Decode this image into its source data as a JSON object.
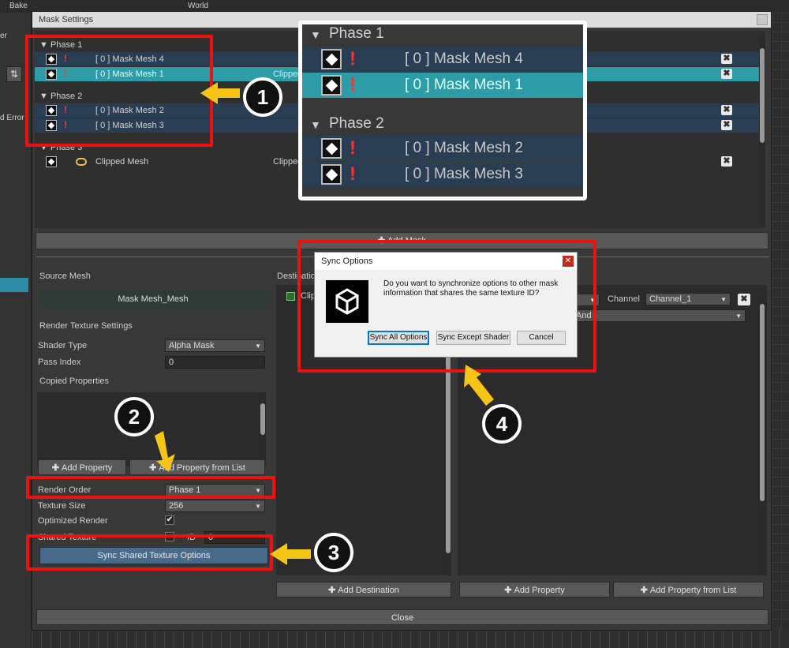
{
  "background": {
    "toolbar_items": [
      "Bake",
      "World"
    ],
    "left_panel_texts": [
      "er",
      "d Error"
    ]
  },
  "window": {
    "title": "Mask Settings",
    "phases": [
      {
        "label": "Phase 1",
        "rows": [
          {
            "name": "[ 0 ] Mask Mesh 4",
            "clip": ""
          },
          {
            "name": "[ 0 ] Mask Mesh 1",
            "clip": "Clipped",
            "selected": true
          }
        ]
      },
      {
        "label": "Phase 2",
        "rows": [
          {
            "name": "[ 0 ] Mask Mesh 2",
            "clip": ""
          },
          {
            "name": "[ 0 ] Mask Mesh 3",
            "clip": ""
          }
        ]
      },
      {
        "label": "Phase 3",
        "rows": [
          {
            "name": "Clipped Mesh",
            "clip": "Clipped"
          }
        ]
      }
    ],
    "add_mask_label": "Add Mask",
    "source_mesh_label": "Source Mesh",
    "source_mesh_value": "Mask Mesh_Mesh",
    "render_texture_settings_label": "Render Texture Settings",
    "shader_type_label": "Shader Type",
    "shader_type_value": "Alpha Mask",
    "pass_index_label": "Pass Index",
    "pass_index_value": "0",
    "copied_properties_label": "Copied Properties",
    "add_property_label": "Add Property",
    "add_property_from_list_label": "Add Property from List",
    "render_order_label": "Render Order",
    "render_order_value": "Phase 1",
    "texture_size_label": "Texture Size",
    "texture_size_value": "256",
    "optimized_render_label": "Optimized Render",
    "optimized_render_checked": true,
    "shared_texture_label": "Shared Texture",
    "shared_id_label": "ID",
    "shared_id_value": "0",
    "sync_shared_label": "Sync Shared Texture Options",
    "destination_label": "Destination",
    "destination_item": "Clipped Mesh",
    "channel_label": "Channel",
    "channel_value": "Channel_1",
    "operation_value": "And",
    "add_destination_label": "Add Destination",
    "add_property_right_label": "Add Property",
    "add_property_from_list_right_label": "Add Property from List",
    "close_label": "Close"
  },
  "zoom": {
    "phase1": "Phase 1",
    "phase2": "Phase 2",
    "rows": [
      {
        "name": "[ 0 ] Mask Mesh 4",
        "selected": false
      },
      {
        "name": "[ 0 ] Mask Mesh 1",
        "selected": true
      },
      {
        "name": "[ 0 ] Mask Mesh 2",
        "selected": false
      },
      {
        "name": "[ 0 ] Mask Mesh 3",
        "selected": false
      }
    ]
  },
  "dialog": {
    "title": "Sync Options",
    "message": "Do you want to synchronize options to other mask information that shares the same texture ID?",
    "sync_all": "Sync All Options",
    "sync_except": "Sync Except Shader",
    "cancel": "Cancel"
  },
  "annotations": [
    "1",
    "2",
    "3",
    "4"
  ],
  "colors": {
    "highlight_red": "#ee1111",
    "arrow_yellow": "#f5c518",
    "selected_row": "#2e9ca6",
    "row_blue": "#2a3e53",
    "button_blue": "#4a6a8a"
  }
}
